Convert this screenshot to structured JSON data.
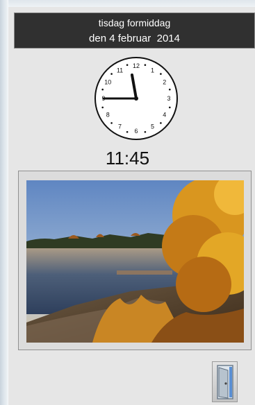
{
  "header": {
    "day_period": "tisdag formiddag",
    "date": "den 4 februar  2014"
  },
  "clock": {
    "numbers": [
      "12",
      "1",
      "2",
      "3",
      "4",
      "5",
      "6",
      "7",
      "8",
      "9",
      "10",
      "11"
    ],
    "time": "11:45"
  },
  "photo": {
    "description_icon": "landscape-photo"
  },
  "exit_button": {
    "icon": "door-icon"
  }
}
